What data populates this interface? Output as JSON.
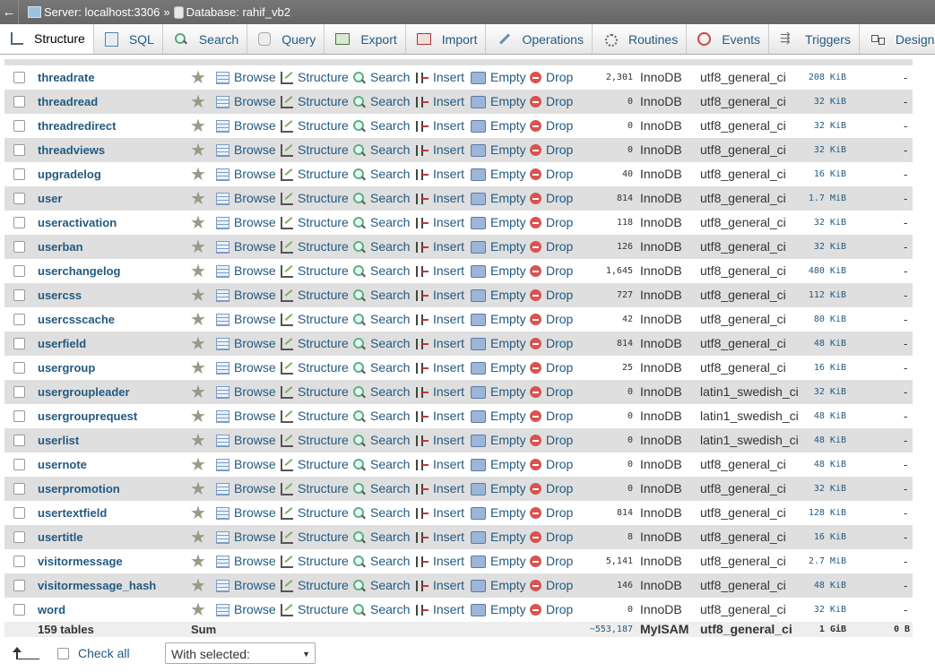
{
  "breadcrumb": {
    "back": "←",
    "server": "Server: localhost:3306",
    "separator": "»",
    "database": "Database: rahif_vb2"
  },
  "tabs": [
    {
      "label": "Structure",
      "icon": "structure-icon",
      "active": true
    },
    {
      "label": "SQL",
      "icon": "sql-icon"
    },
    {
      "label": "Search",
      "icon": "search-icon"
    },
    {
      "label": "Query",
      "icon": "query-icon"
    },
    {
      "label": "Export",
      "icon": "export-icon"
    },
    {
      "label": "Import",
      "icon": "import-icon"
    },
    {
      "label": "Operations",
      "icon": "wrench-icon"
    },
    {
      "label": "Routines",
      "icon": "routines-icon"
    },
    {
      "label": "Events",
      "icon": "clock-icon"
    },
    {
      "label": "Triggers",
      "icon": "triggers-icon"
    },
    {
      "label": "Designer",
      "icon": "designer-icon"
    }
  ],
  "actions": {
    "browse": "Browse",
    "structure": "Structure",
    "search": "Search",
    "insert": "Insert",
    "empty": "Empty",
    "drop": "Drop"
  },
  "tables": [
    {
      "name": "threadrate",
      "rows": "2,301",
      "engine": "InnoDB",
      "collation": "utf8_general_ci",
      "size": "208 KiB",
      "overhead": "-"
    },
    {
      "name": "threadread",
      "rows": "0",
      "engine": "InnoDB",
      "collation": "utf8_general_ci",
      "size": "32 KiB",
      "overhead": "-"
    },
    {
      "name": "threadredirect",
      "rows": "0",
      "engine": "InnoDB",
      "collation": "utf8_general_ci",
      "size": "32 KiB",
      "overhead": "-"
    },
    {
      "name": "threadviews",
      "rows": "0",
      "engine": "InnoDB",
      "collation": "utf8_general_ci",
      "size": "32 KiB",
      "overhead": "-"
    },
    {
      "name": "upgradelog",
      "rows": "40",
      "engine": "InnoDB",
      "collation": "utf8_general_ci",
      "size": "16 KiB",
      "overhead": "-"
    },
    {
      "name": "user",
      "rows": "814",
      "engine": "InnoDB",
      "collation": "utf8_general_ci",
      "size": "1.7 MiB",
      "overhead": "-"
    },
    {
      "name": "useractivation",
      "rows": "118",
      "engine": "InnoDB",
      "collation": "utf8_general_ci",
      "size": "32 KiB",
      "overhead": "-"
    },
    {
      "name": "userban",
      "rows": "126",
      "engine": "InnoDB",
      "collation": "utf8_general_ci",
      "size": "32 KiB",
      "overhead": "-"
    },
    {
      "name": "userchangelog",
      "rows": "1,645",
      "engine": "InnoDB",
      "collation": "utf8_general_ci",
      "size": "480 KiB",
      "overhead": "-"
    },
    {
      "name": "usercss",
      "rows": "727",
      "engine": "InnoDB",
      "collation": "utf8_general_ci",
      "size": "112 KiB",
      "overhead": "-"
    },
    {
      "name": "usercsscache",
      "rows": "42",
      "engine": "InnoDB",
      "collation": "utf8_general_ci",
      "size": "80 KiB",
      "overhead": "-"
    },
    {
      "name": "userfield",
      "rows": "814",
      "engine": "InnoDB",
      "collation": "utf8_general_ci",
      "size": "48 KiB",
      "overhead": "-"
    },
    {
      "name": "usergroup",
      "rows": "25",
      "engine": "InnoDB",
      "collation": "utf8_general_ci",
      "size": "16 KiB",
      "overhead": "-"
    },
    {
      "name": "usergroupleader",
      "rows": "0",
      "engine": "InnoDB",
      "collation": "latin1_swedish_ci",
      "size": "32 KiB",
      "overhead": "-"
    },
    {
      "name": "usergrouprequest",
      "rows": "0",
      "engine": "InnoDB",
      "collation": "latin1_swedish_ci",
      "size": "48 KiB",
      "overhead": "-"
    },
    {
      "name": "userlist",
      "rows": "0",
      "engine": "InnoDB",
      "collation": "latin1_swedish_ci",
      "size": "48 KiB",
      "overhead": "-"
    },
    {
      "name": "usernote",
      "rows": "0",
      "engine": "InnoDB",
      "collation": "utf8_general_ci",
      "size": "48 KiB",
      "overhead": "-"
    },
    {
      "name": "userpromotion",
      "rows": "0",
      "engine": "InnoDB",
      "collation": "utf8_general_ci",
      "size": "32 KiB",
      "overhead": "-"
    },
    {
      "name": "usertextfield",
      "rows": "814",
      "engine": "InnoDB",
      "collation": "utf8_general_ci",
      "size": "128 KiB",
      "overhead": "-"
    },
    {
      "name": "usertitle",
      "rows": "8",
      "engine": "InnoDB",
      "collation": "utf8_general_ci",
      "size": "16 KiB",
      "overhead": "-"
    },
    {
      "name": "visitormessage",
      "rows": "5,141",
      "engine": "InnoDB",
      "collation": "utf8_general_ci",
      "size": "2.7 MiB",
      "overhead": "-"
    },
    {
      "name": "visitormessage_hash",
      "rows": "146",
      "engine": "InnoDB",
      "collation": "utf8_general_ci",
      "size": "48 KiB",
      "overhead": "-"
    },
    {
      "name": "word",
      "rows": "0",
      "engine": "InnoDB",
      "collation": "utf8_general_ci",
      "size": "32 KiB",
      "overhead": "-"
    }
  ],
  "summary": {
    "count": "159 tables",
    "label": "Sum",
    "rows": "~553,187",
    "engine": "MyISAM",
    "collation": "utf8_general_ci",
    "size": "1 GiB",
    "overhead": "0 B"
  },
  "footer": {
    "check_all": "Check all",
    "with_selected": "With selected:"
  }
}
